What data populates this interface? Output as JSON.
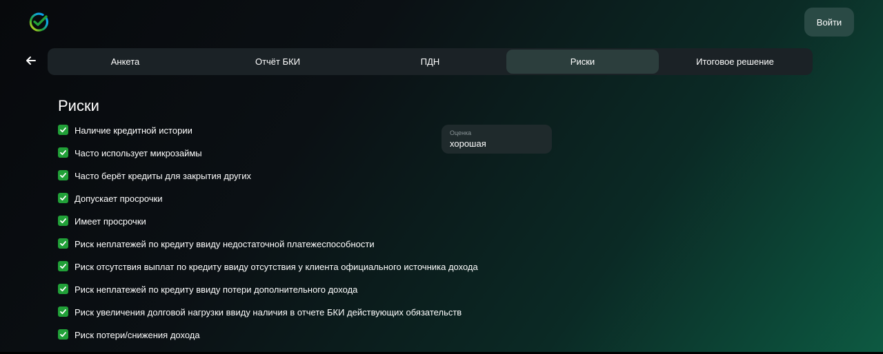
{
  "header": {
    "logo_icon": "sber-logo-icon",
    "login_label": "Войти"
  },
  "nav": {
    "back_icon": "arrow-left-icon",
    "tabs": [
      {
        "label": "Анкета",
        "active": false
      },
      {
        "label": "Отчёт БКИ",
        "active": false
      },
      {
        "label": "ПДН",
        "active": false
      },
      {
        "label": "Риски",
        "active": true
      },
      {
        "label": "Итоговое решение",
        "active": false
      }
    ]
  },
  "main": {
    "title": "Риски",
    "risks": [
      {
        "label": "Наличие кредитной истории",
        "checked": true
      },
      {
        "label": "Часто использует микрозаймы",
        "checked": true
      },
      {
        "label": "Часто берёт кредиты для закрытия других",
        "checked": true
      },
      {
        "label": "Допускает просрочки",
        "checked": true
      },
      {
        "label": "Имеет просрочки",
        "checked": true
      },
      {
        "label": "Риск неплатежей по кредиту ввиду недостаточной платежеспособности",
        "checked": true
      },
      {
        "label": "Риск отсутствия выплат по кредиту ввиду отсутствия у клиента официального источника дохода",
        "checked": true
      },
      {
        "label": "Риск неплатежей по кредиту ввиду потери дополнительного дохода",
        "checked": true
      },
      {
        "label": "Риск увеличения долговой нагрузки ввиду наличия в отчете БКИ действующих обязательств",
        "checked": true
      },
      {
        "label": "Риск потери/снижения дохода",
        "checked": true
      }
    ],
    "assessment": {
      "label": "Оценка",
      "value": "хорошая"
    }
  },
  "colors": {
    "accent_green": "#21a038",
    "active_tab": "#2c3e3d",
    "tab_bar": "#1b2226",
    "login_button": "#2a4a45"
  }
}
